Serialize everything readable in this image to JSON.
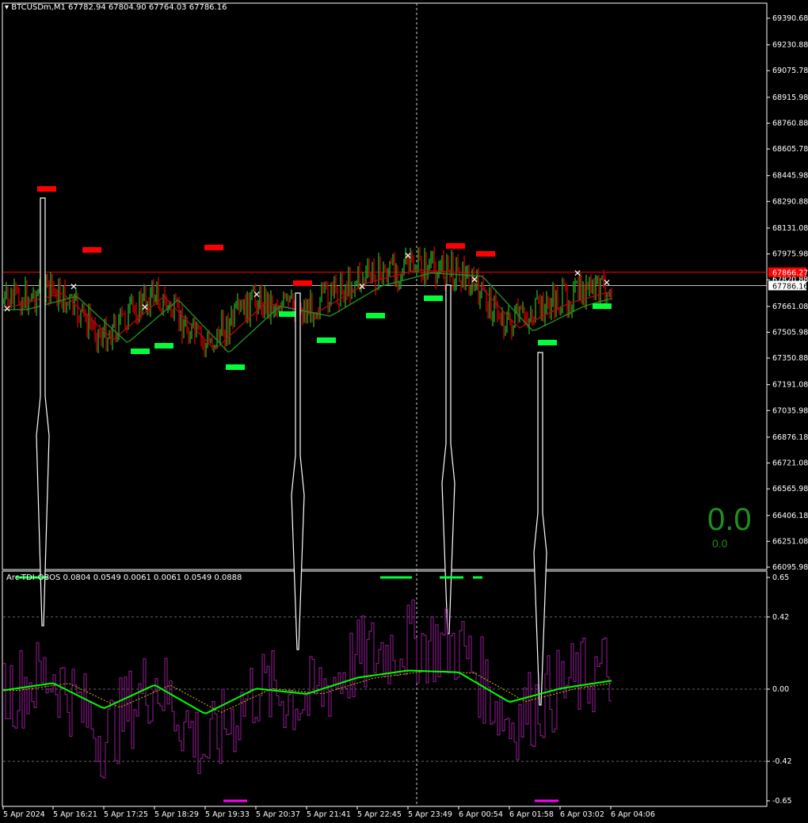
{
  "header": {
    "symbol": "BTCUSDm,M1",
    "ohlc": "67782.94 67804.90 67764.03 67786.16"
  },
  "indicator_header": {
    "name": "Arc-TDI-OBOS",
    "values": "0.0804 0.0549 0.0061 0.0061 0.0549 0.0888"
  },
  "overlay": {
    "big_value": "0.0",
    "small_value": "0.0"
  },
  "price_axis": {
    "ticks": [
      "69390.68",
      "69230.88",
      "69075.78",
      "68915.98",
      "68760.88",
      "68605.78",
      "68445.98",
      "68290.88",
      "68131.08",
      "67975.98",
      "67820.88",
      "67661.08",
      "67505.98",
      "67350.88",
      "67191.08",
      "67035.98",
      "66876.18",
      "66721.08",
      "66565.98",
      "66406.18",
      "66251.08",
      "66095.98"
    ],
    "ask_label": "67866.27",
    "bid_label": "67786.16",
    "hidden_label": "67820.88"
  },
  "indicator_axis": {
    "ticks": [
      "0.65",
      "0.42",
      "0.00",
      "-0.42",
      "-0.65"
    ]
  },
  "time_axis": {
    "labels": [
      "5 Apr 2024",
      "5 Apr 16:21",
      "5 Apr 17:25",
      "5 Apr 18:29",
      "5 Apr 19:33",
      "5 Apr 20:37",
      "5 Apr 21:41",
      "5 Apr 22:45",
      "5 Apr 23:49",
      "6 Apr 00:54",
      "6 Apr 01:58",
      "6 Apr 03:02",
      "6 Apr 04:06"
    ]
  },
  "colors": {
    "bull": "#1f8f1f",
    "bear": "#b00000",
    "signal_buy": "#00ff3a",
    "signal_sell": "#ff0000",
    "ask_line": "#ff0000",
    "bid_line": "#c0c0c0",
    "tdi_up": "#00ff00",
    "tdi_down": "#ff0000",
    "rsi_line": "#8b1a8b",
    "ob_os_bar": "#ff00ff"
  },
  "chart_data": [
    {
      "type": "candlestick",
      "title": "BTCUSDm,M1",
      "ylim": [
        66095.98,
        69390.68
      ],
      "x_labels": [
        "5 Apr 2024",
        "5 Apr 16:21",
        "5 Apr 17:25",
        "5 Apr 18:29",
        "5 Apr 19:33",
        "5 Apr 20:37",
        "5 Apr 21:41",
        "5 Apr 22:45",
        "5 Apr 23:49",
        "6 Apr 00:54",
        "6 Apr 01:58",
        "6 Apr 03:02",
        "6 Apr 04:06"
      ],
      "close_path": [
        [
          "5 Apr 2024",
          67680
        ],
        [
          "5 Apr 16:21",
          67760
        ],
        [
          "5 Apr 17:25",
          67480
        ],
        [
          "5 Apr 18:29",
          67740
        ],
        [
          "5 Apr 19:33",
          67420
        ],
        [
          "5 Apr 20:37",
          67700
        ],
        [
          "5 Apr 21:41",
          67640
        ],
        [
          "5 Apr 22:45",
          67820
        ],
        [
          "5 Apr 23:49",
          67900
        ],
        [
          "6 Apr 00:54",
          67880
        ],
        [
          "6 Apr 01:58",
          67550
        ],
        [
          "6 Apr 03:02",
          67700
        ],
        [
          "6 Apr 04:06",
          67786.16
        ]
      ],
      "series": [
        {
          "name": "BTCUSDm,M1",
          "values": [
            67680,
            67760,
            67480,
            67740,
            67420,
            67700,
            67640,
            67820,
            67900,
            67880,
            67550,
            67700,
            67786.16
          ]
        }
      ],
      "last": {
        "open": 67782.94,
        "high": 67804.9,
        "low": 67764.03,
        "close": 67786.16
      },
      "ask": 67866.27,
      "bid": 67786.16
    },
    {
      "type": "line",
      "title": "Arc-TDI-OBOS",
      "ylim": [
        -0.65,
        0.65
      ],
      "levels": [
        0.65,
        0.42,
        0.0,
        -0.42,
        -0.65
      ],
      "series": [
        {
          "name": "Arc-TDI-OBOS",
          "values": [
            0.0804,
            0.0549,
            0.0061,
            0.0061,
            0.0549,
            0.0888
          ]
        }
      ]
    }
  ]
}
